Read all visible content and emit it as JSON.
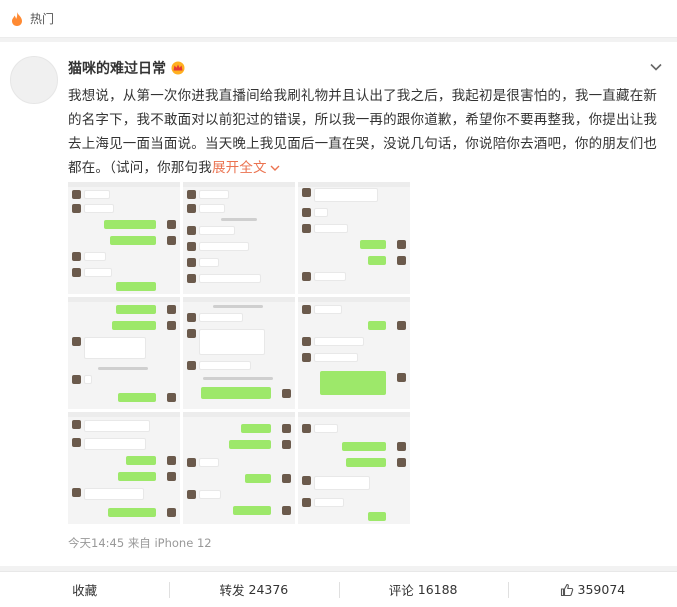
{
  "topbar": {
    "icon": "fire-icon",
    "label": "热门"
  },
  "post": {
    "username": "猫咪的难过日常",
    "badge_icon": "crown-icon",
    "text": "我想说，从第一次你进我直播间给我刷礼物并且认出了我之后，我起初是很害怕的，我一直藏在新的名字下，我不敢面对以前犯过的错误，所以我一再的跟你道歉，希望你不要再整我，你提出让我去上海见一面当面说。当天晚上我见面后一直在哭，没说几句话，你说陪你去酒吧，你的朋友们也都在。（试问，你那句我",
    "expand_label": "展开全文",
    "image_count": 9,
    "time": "今天14:45",
    "source": "来自 iPhone 12"
  },
  "actions": {
    "favorite": "收藏",
    "repost_label": "转发",
    "repost_count": "24376",
    "comment_label": "评论",
    "comment_count": "16188",
    "like_count": "359074"
  }
}
